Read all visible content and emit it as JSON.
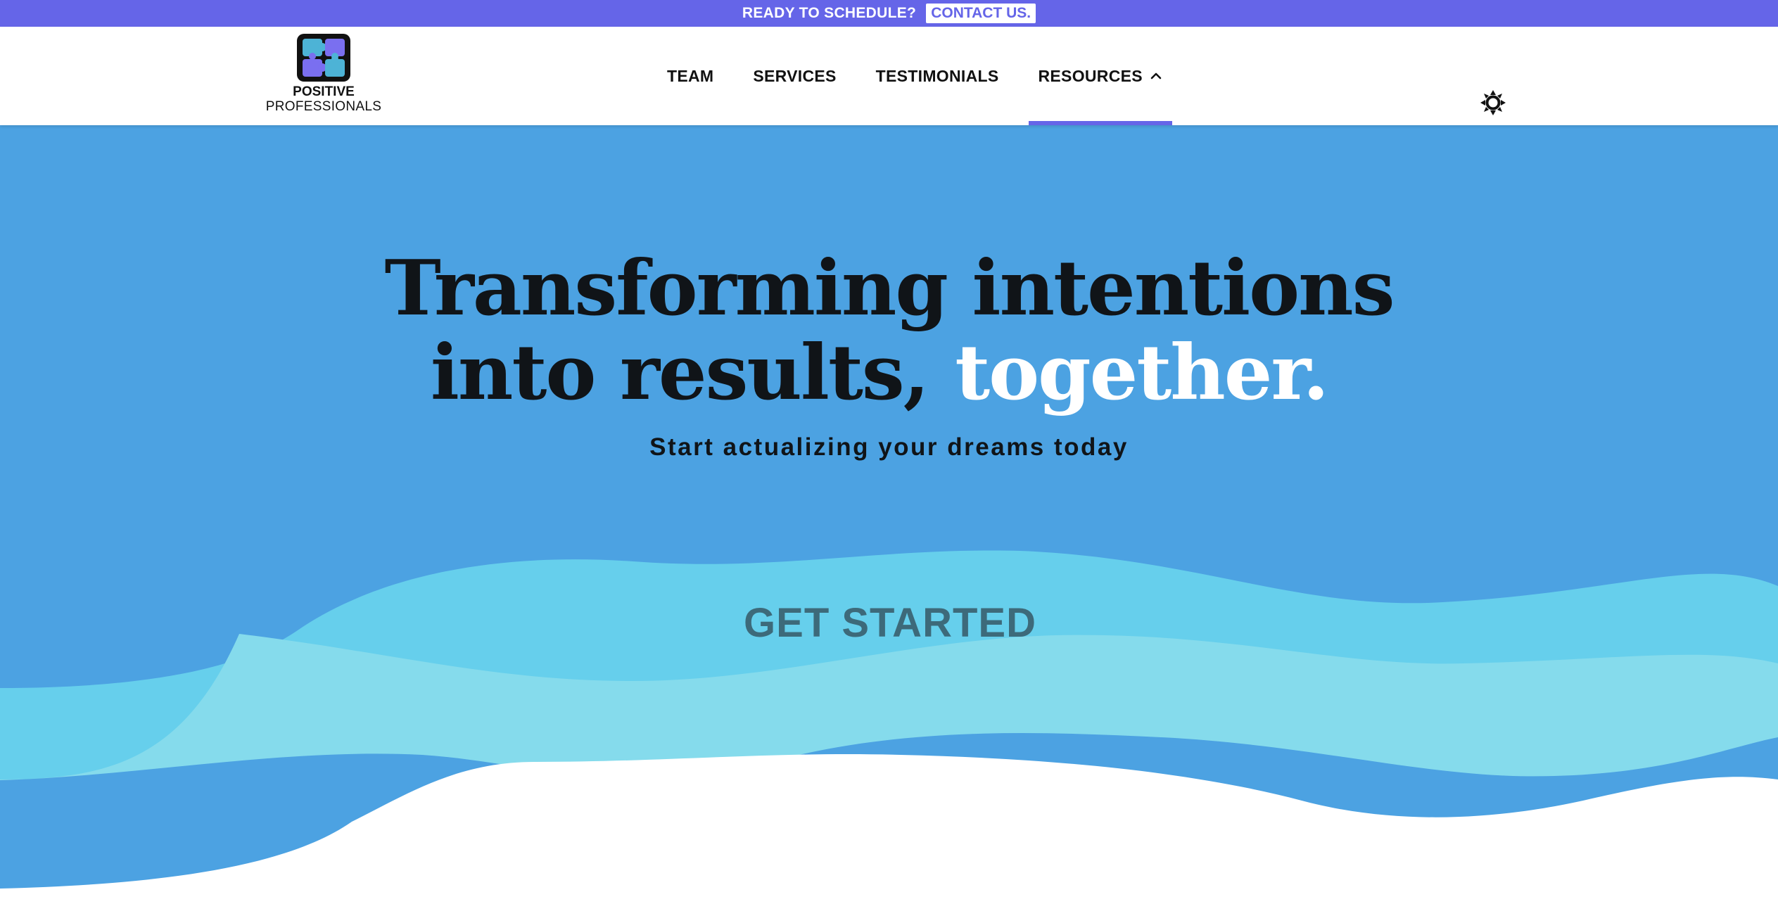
{
  "banner": {
    "text": "READY TO SCHEDULE?",
    "link_label": "CONTACT US."
  },
  "header": {
    "logo": {
      "line1": "POSITIVE",
      "line2": "PROFESSIONALS",
      "icon": "puzzle-pieces-icon"
    },
    "nav": [
      {
        "label": "TEAM"
      },
      {
        "label": "SERVICES"
      },
      {
        "label": "TESTIMONIALS"
      },
      {
        "label": "RESOURCES",
        "icon": "chevron-up-icon",
        "active": true
      }
    ],
    "theme_toggle_icon": "sun-icon"
  },
  "hero": {
    "headline_line1": "Transforming intentions",
    "headline_line2": "into results,",
    "headline_highlight": "together.",
    "subheadline": "Start actualizing your dreams today",
    "cta_label": "GET STARTED"
  },
  "colors": {
    "accent": "#6565e8",
    "hero_bg": "#4ca2e2",
    "wave_light": "#66cfec",
    "wave_pale": "#85dbec",
    "text_dark": "#101418",
    "cta_text": "#3d6a7a"
  }
}
